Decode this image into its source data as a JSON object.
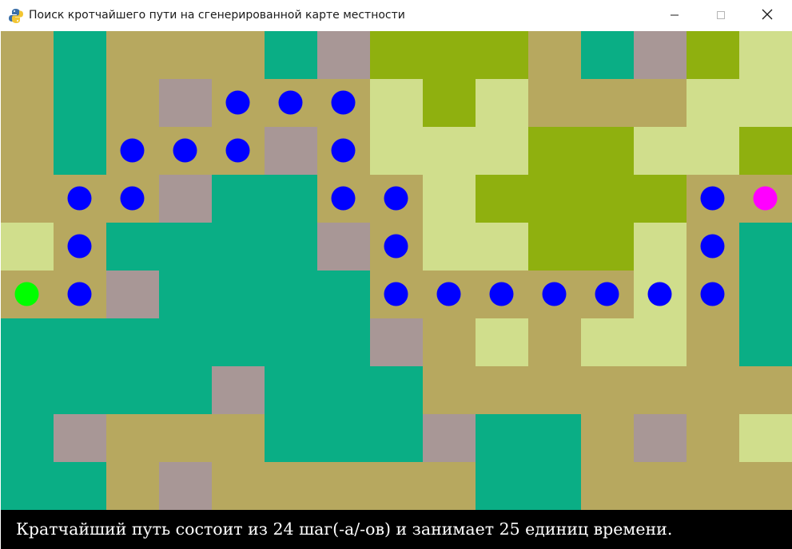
{
  "window": {
    "title": "Поиск кротчайшего пути на сгенерированной карте местности",
    "app_icon": "python-snake-icon",
    "controls": [
      "minimize-icon",
      "maximize-icon",
      "close-icon"
    ]
  },
  "map": {
    "columns": 15,
    "rows": 10,
    "legend_codes": {
      "S": "sand",
      "T": "teal",
      "R": "rock",
      "O": "olive",
      "L": "light-grass"
    },
    "colors": {
      "S": "#b7a85f",
      "T": "#0aae85",
      "R": "#a89796",
      "O": "#8fb00f",
      "L": "#d0de8c",
      "path": "#0000ff",
      "start": "#00ff00",
      "end": "#ff00ff"
    },
    "tiles": [
      "STSSSTROOOSTROL",
      "STSRSSSLOLSSSLL",
      "STSSSRSLLLOOLLO",
      "SSSRTTSSLOOOOSS",
      "LSTTTTRSLLOOLST",
      "SSRTTTTSSSSSLST",
      "TTTTTTTRSLSLLST",
      "TTTTRTTTSSSSSSS",
      "TRSSSTTTRTTSRSL",
      "TTSRSSSSSTTSSSS"
    ],
    "start": [
      0,
      5
    ],
    "end": [
      14,
      3
    ],
    "path": [
      [
        1,
        5
      ],
      [
        1,
        4
      ],
      [
        1,
        3
      ],
      [
        2,
        3
      ],
      [
        2,
        2
      ],
      [
        3,
        2
      ],
      [
        4,
        2
      ],
      [
        4,
        1
      ],
      [
        5,
        1
      ],
      [
        6,
        1
      ],
      [
        6,
        2
      ],
      [
        6,
        3
      ],
      [
        7,
        3
      ],
      [
        7,
        4
      ],
      [
        7,
        5
      ],
      [
        8,
        5
      ],
      [
        9,
        5
      ],
      [
        10,
        5
      ],
      [
        11,
        5
      ],
      [
        12,
        5
      ],
      [
        13,
        5
      ],
      [
        13,
        4
      ],
      [
        13,
        3
      ]
    ]
  },
  "status": {
    "message": "Кратчайший путь состоит из 24 шаг(-а/-ов) и занимает 25 единиц времени."
  }
}
